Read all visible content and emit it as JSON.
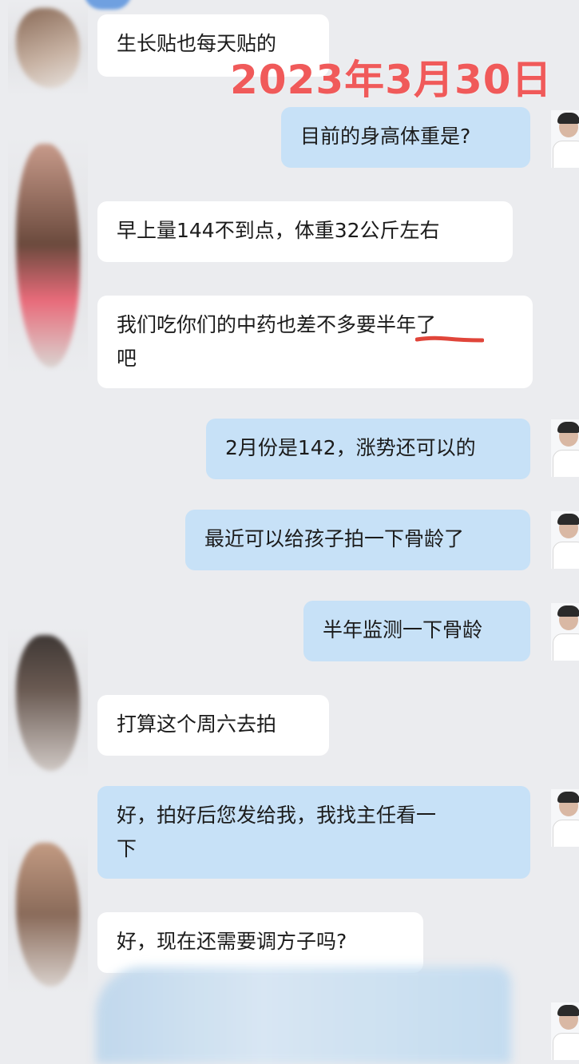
{
  "date_stamp": "2023年3月30日",
  "messages": [
    {
      "side": "in",
      "text": "生长贴也每天贴的"
    },
    {
      "side": "out",
      "text": "目前的身高体重是?"
    },
    {
      "side": "in",
      "text": "早上量144不到点，体重32公斤左右"
    },
    {
      "side": "in",
      "text": "我们吃你们的中药也差不多要半年了\n吧"
    },
    {
      "side": "out",
      "text": "2月份是142，涨势还可以的"
    },
    {
      "side": "out",
      "text": "最近可以给孩子拍一下骨龄了"
    },
    {
      "side": "out",
      "text": "半年监测一下骨龄"
    },
    {
      "side": "in",
      "text": "打算这个周六去拍"
    },
    {
      "side": "out",
      "text": "好，拍好后您发给我，我找主任看一\n下"
    },
    {
      "side": "in",
      "text": "好，现在还需要调方子吗?"
    }
  ],
  "colors": {
    "incoming_bubble": "#ffffff",
    "outgoing_bubble": "#c7e1f7",
    "date_stamp": "#f05a5a",
    "underline": "#e0453a"
  }
}
